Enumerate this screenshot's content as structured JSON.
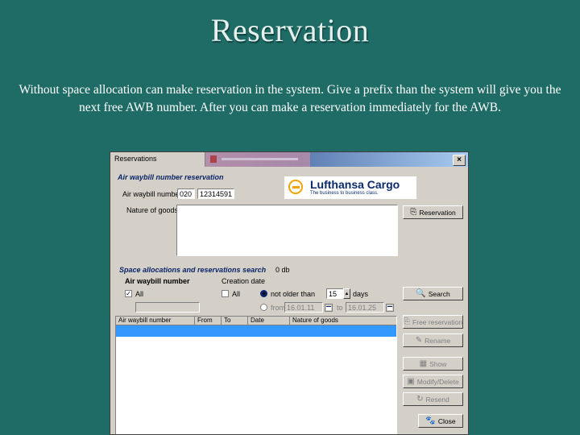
{
  "slide": {
    "title": "Reservation",
    "description": "Without space allocation can make reservation in the system. Give a prefix than the system will give you the next free AWB number. After you can make a reservation immediately for the AWB."
  },
  "window": {
    "title": "Reservations",
    "second_title": "",
    "close_label": "×"
  },
  "awb_reservation": {
    "heading": "Air waybill number reservation",
    "awb_label": "Air waybill number:",
    "prefix_value": "020",
    "number_value": "12314591",
    "nature_label": "Nature of goods:",
    "nature_value": "",
    "reservation_button": "Reservation"
  },
  "logo": {
    "name": "Lufthansa Cargo",
    "tagline": "The business to business class."
  },
  "search": {
    "heading": "Space allocations and reservations search",
    "heading_extra": "0 db",
    "awb_group_label": "Air waybill number",
    "all_awb_label": "All",
    "all_awb_checked": true,
    "awb_filter_value": "",
    "creation_group_label": "Creation date",
    "all_date_label": "All",
    "not_older_label": "not older than",
    "days_value": "15",
    "days_label": "days",
    "from_label": "from",
    "from_value": "16.01.11",
    "to_label": "to",
    "to_value": "16.01.25",
    "search_button": "Search"
  },
  "table": {
    "columns": [
      "Air waybill number",
      "From",
      "To",
      "Date",
      "Nature of goods"
    ],
    "rows": []
  },
  "actions": {
    "free_reservation": "Free reservation",
    "rename": "Rename",
    "show": "Show",
    "modify_delete": "Modify/Delete",
    "resend": "Resend",
    "close": "Close"
  },
  "colors": {
    "slide_background": "#1f6b66",
    "selection": "#3399ff",
    "section_heading": "#0a246a"
  }
}
